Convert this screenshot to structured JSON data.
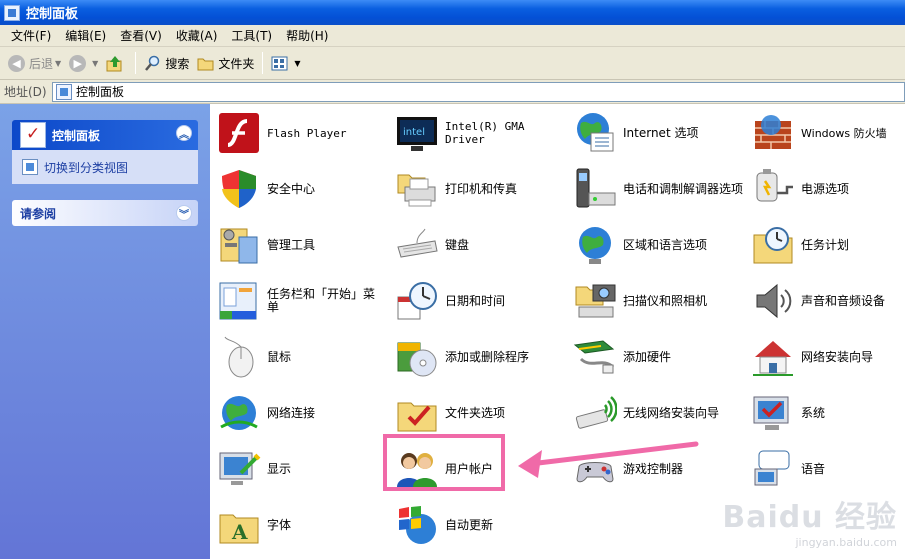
{
  "window": {
    "title": "控制面板"
  },
  "menu": [
    "文件(F)",
    "编辑(E)",
    "查看(V)",
    "收藏(A)",
    "工具(T)",
    "帮助(H)"
  ],
  "toolbar": {
    "back": "后退",
    "search": "搜索",
    "folders": "文件夹"
  },
  "address": {
    "label": "地址(D)",
    "value": "控制面板"
  },
  "sidebar": {
    "panel1": {
      "title": "控制面板",
      "link": "切换到分类视图"
    },
    "panel2": {
      "title": "请参阅"
    }
  },
  "items": [
    {
      "label": "Flash Player",
      "icon": "flash-icon"
    },
    {
      "label": "安全中心",
      "icon": "shield-icon"
    },
    {
      "label": "管理工具",
      "icon": "tools-icon"
    },
    {
      "label": "任务栏和「开始」菜单",
      "icon": "taskbar-icon"
    },
    {
      "label": "鼠标",
      "icon": "mouse-icon"
    },
    {
      "label": "网络连接",
      "icon": "network-globe-icon"
    },
    {
      "label": "显示",
      "icon": "monitor-icon"
    },
    {
      "label": "字体",
      "icon": "font-folder-icon"
    },
    {
      "label": "Intel(R) GMA Driver",
      "icon": "intel-monitor-icon"
    },
    {
      "label": "打印机和传真",
      "icon": "printer-icon"
    },
    {
      "label": "键盘",
      "icon": "keyboard-icon"
    },
    {
      "label": "日期和时间",
      "icon": "clock-calendar-icon"
    },
    {
      "label": "添加或删除程序",
      "icon": "cd-box-icon"
    },
    {
      "label": "文件夹选项",
      "icon": "folder-check-icon"
    },
    {
      "label": "用户帐户",
      "icon": "users-icon"
    },
    {
      "label": "自动更新",
      "icon": "windows-globe-icon"
    },
    {
      "label": "Internet 选项",
      "icon": "globe-list-icon"
    },
    {
      "label": "电话和调制解调器选项",
      "icon": "phone-modem-icon"
    },
    {
      "label": "区域和语言选项",
      "icon": "globe-icon"
    },
    {
      "label": "扫描仪和照相机",
      "icon": "scanner-camera-icon"
    },
    {
      "label": "添加硬件",
      "icon": "hardware-icon"
    },
    {
      "label": "无线网络安装向导",
      "icon": "wireless-icon"
    },
    {
      "label": "游戏控制器",
      "icon": "gamepad-icon"
    },
    {
      "label": "Windows 防火墙",
      "icon": "firewall-icon"
    },
    {
      "label": "电源选项",
      "icon": "power-icon"
    },
    {
      "label": "任务计划",
      "icon": "task-folder-icon"
    },
    {
      "label": "声音和音频设备",
      "icon": "speaker-icon"
    },
    {
      "label": "网络安装向导",
      "icon": "home-network-icon"
    },
    {
      "label": "系统",
      "icon": "system-monitor-icon"
    },
    {
      "label": "语音",
      "icon": "speech-icon"
    }
  ],
  "watermark": {
    "brand": "Baidu 经验",
    "url": "jingyan.baidu.com"
  },
  "colors": {
    "highlight": "#f06aa8",
    "xp_blue": "#0a5fe0"
  }
}
